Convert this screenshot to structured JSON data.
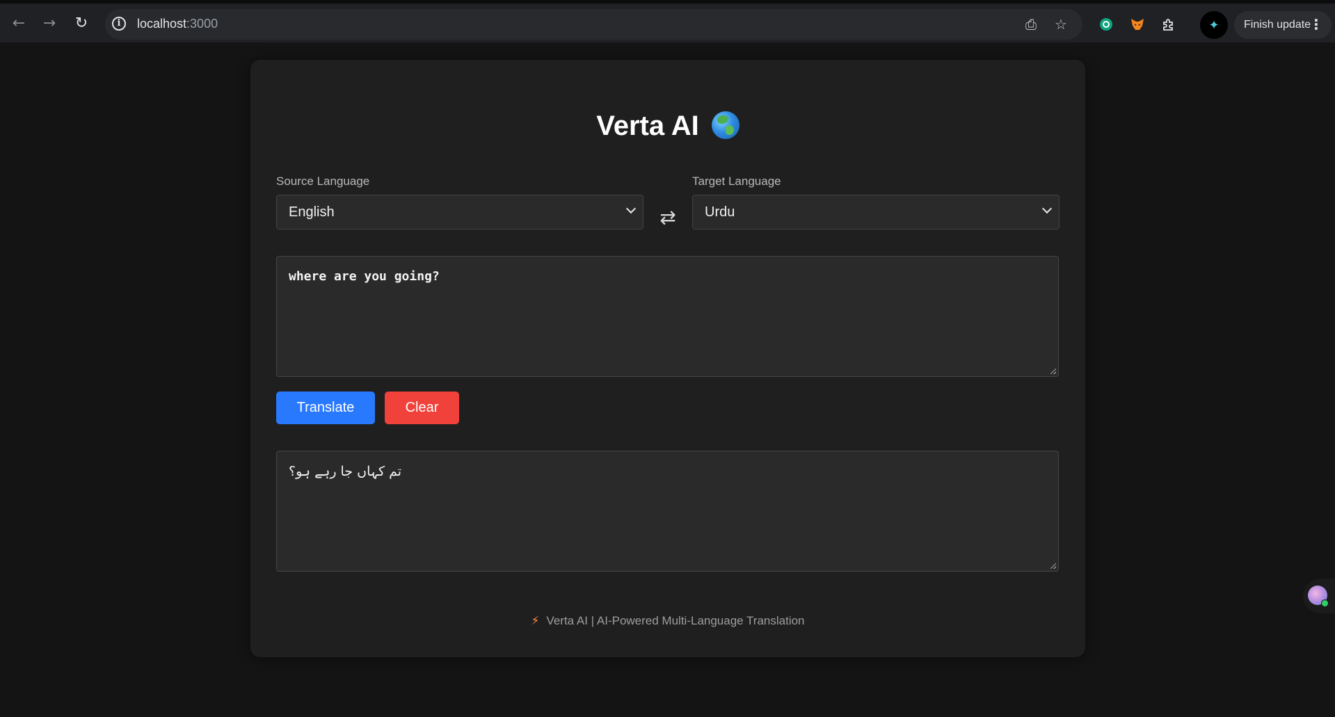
{
  "browser": {
    "url_host": "localhost",
    "url_port": ":3000",
    "finish_update_label": "Finish update"
  },
  "app": {
    "title": "Verta AI",
    "source_language_label": "Source Language",
    "source_language_value": "English",
    "target_language_label": "Target Language",
    "target_language_value": "Urdu",
    "input_text": "where are you going?",
    "translate_label": "Translate",
    "clear_label": "Clear",
    "output_text": "تم کہاں جا رہے ہو؟",
    "footer_text": "Verta AI | AI-Powered Multi-Language Translation"
  },
  "colors": {
    "translate_button": "#2979ff",
    "clear_button": "#f0413a",
    "background": "#141414",
    "card": "#1f1f1f"
  },
  "icons": {
    "swap": "swap-icon",
    "globe": "globe-icon",
    "footer": "lightning-icon"
  }
}
